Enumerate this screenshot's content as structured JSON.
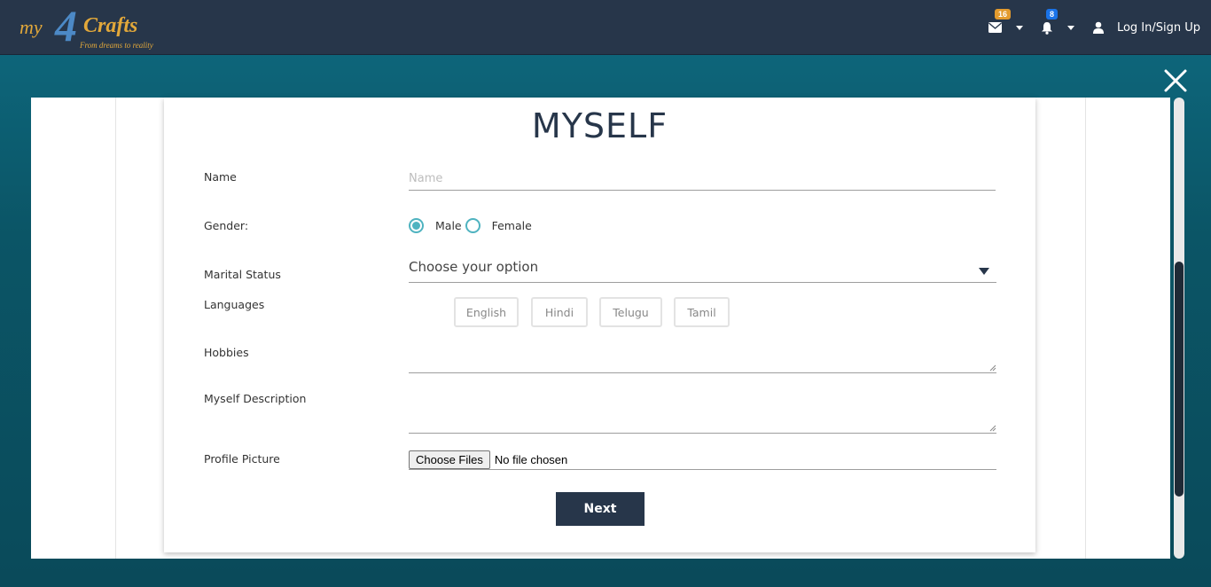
{
  "brand": {
    "logo_my": "my",
    "logo_four": "4",
    "logo_crafts": "Crafts",
    "tagline": "From dreams to reality"
  },
  "nav": {
    "messages_icon": "envelope-icon",
    "messages_count": "16",
    "notifications_icon": "bell-icon",
    "notifications_count": "8",
    "user_icon": "user-icon",
    "login_label": "Log In/Sign Up",
    "badge_colors": {
      "messages": "#e39b2e",
      "notifications": "#1a73e8"
    }
  },
  "form": {
    "title": "MYSELF",
    "name_label": "Name",
    "name_placeholder": "Name",
    "name_value": "",
    "gender_label": "Gender:",
    "gender_options": [
      "Male",
      "Female"
    ],
    "gender_selected": "Male",
    "marital_label": "Marital Status",
    "marital_value": "Choose your option",
    "languages_label": "Languages",
    "languages": [
      "English",
      "Hindi",
      "Telugu",
      "Tamil"
    ],
    "hobbies_label": "Hobbies",
    "description_label": "Myself Description",
    "picture_label": "Profile Picture",
    "file_button": "Choose Files",
    "file_status": "No file chosen",
    "next_label": "Next"
  },
  "colors": {
    "header_bg": "#27364a",
    "accent": "#4fb3c0",
    "page_bg": "#0b5566"
  }
}
